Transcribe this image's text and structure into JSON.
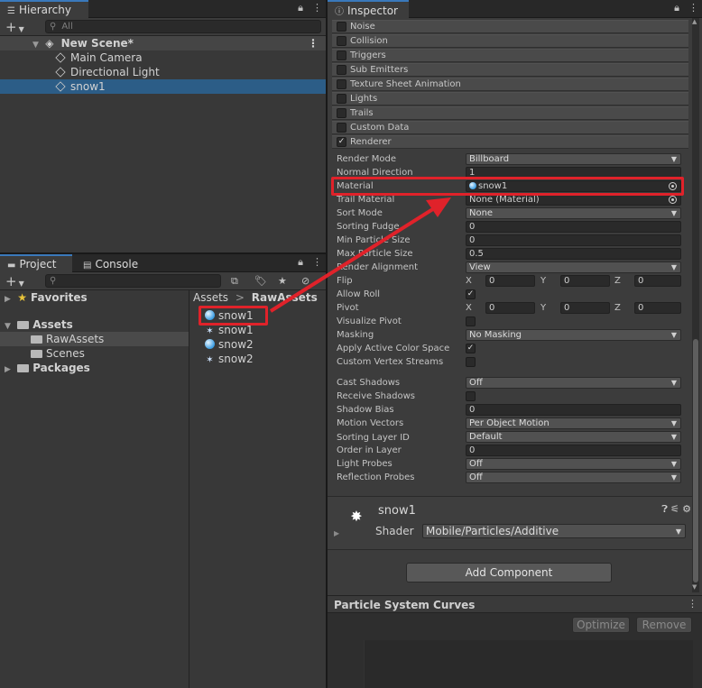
{
  "hierarchy": {
    "tab_label": "Hierarchy",
    "search_placeholder": "All",
    "scene_name": "New Scene*",
    "items": [
      "Main Camera",
      "Directional Light",
      "snow1"
    ]
  },
  "project": {
    "tabs": [
      "Project",
      "Console"
    ],
    "tree": {
      "favorites": "Favorites",
      "assets": "Assets",
      "raw_assets": "RawAssets",
      "scenes": "Scenes",
      "packages": "Packages"
    },
    "breadcrumb": [
      "Assets",
      "RawAssets"
    ],
    "files": [
      {
        "name": "snow1",
        "icon": "material-ball-icon"
      },
      {
        "name": "snow1",
        "icon": "particle-system-icon"
      },
      {
        "name": "snow2",
        "icon": "material-ball-icon"
      },
      {
        "name": "snow2",
        "icon": "particle-system-icon"
      }
    ]
  },
  "inspector": {
    "tab_label": "Inspector",
    "modules": [
      {
        "label": "Noise",
        "checked": false
      },
      {
        "label": "Collision",
        "checked": false
      },
      {
        "label": "Triggers",
        "checked": false
      },
      {
        "label": "Sub Emitters",
        "checked": false
      },
      {
        "label": "Texture Sheet Animation",
        "checked": false
      },
      {
        "label": "Lights",
        "checked": false
      },
      {
        "label": "Trails",
        "checked": false
      },
      {
        "label": "Custom Data",
        "checked": false
      },
      {
        "label": "Renderer",
        "checked": true
      }
    ],
    "renderer": {
      "render_mode": {
        "label": "Render Mode",
        "value": "Billboard"
      },
      "normal_direction": {
        "label": "Normal Direction",
        "value": "1"
      },
      "material": {
        "label": "Material",
        "value": "snow1"
      },
      "trail_material": {
        "label": "Trail Material",
        "value": "None (Material)"
      },
      "sort_mode": {
        "label": "Sort Mode",
        "value": "None"
      },
      "sorting_fudge": {
        "label": "Sorting Fudge",
        "value": "0"
      },
      "min_particle_size": {
        "label": "Min Particle Size",
        "value": "0"
      },
      "max_particle_size": {
        "label": "Max Particle Size",
        "value": "0.5"
      },
      "render_alignment": {
        "label": "Render Alignment",
        "value": "View"
      },
      "flip": {
        "label": "Flip",
        "x": "0",
        "y": "0",
        "z": "0"
      },
      "allow_roll": {
        "label": "Allow Roll",
        "checked": true
      },
      "pivot": {
        "label": "Pivot",
        "x": "0",
        "y": "0",
        "z": "0"
      },
      "visualize_pivot": {
        "label": "Visualize Pivot",
        "checked": false
      },
      "masking": {
        "label": "Masking",
        "value": "No Masking"
      },
      "apply_active_color_space": {
        "label": "Apply Active Color Space",
        "checked": true
      },
      "custom_vertex_streams": {
        "label": "Custom Vertex Streams",
        "checked": false
      },
      "cast_shadows": {
        "label": "Cast Shadows",
        "value": "Off"
      },
      "receive_shadows": {
        "label": "Receive Shadows",
        "checked": false
      },
      "shadow_bias": {
        "label": "Shadow Bias",
        "value": "0"
      },
      "motion_vectors": {
        "label": "Motion Vectors",
        "value": "Per Object Motion"
      },
      "sorting_layer_id": {
        "label": "Sorting Layer ID",
        "value": "Default"
      },
      "order_in_layer": {
        "label": "Order in Layer",
        "value": "0"
      },
      "light_probes": {
        "label": "Light Probes",
        "value": "Off"
      },
      "reflection_probes": {
        "label": "Reflection Probes",
        "value": "Off"
      }
    },
    "axis_labels": {
      "x": "X",
      "y": "Y",
      "z": "Z"
    },
    "material_section": {
      "name": "snow1",
      "shader_label": "Shader",
      "shader_value": "Mobile/Particles/Additive"
    },
    "add_component_label": "Add Component",
    "curves": {
      "title": "Particle System Curves",
      "optimize_label": "Optimize",
      "remove_label": "Remove"
    }
  },
  "colors": {
    "highlight": "#e0222a",
    "selection": "#2c5d87",
    "tab_accent": "#3a79bb"
  }
}
